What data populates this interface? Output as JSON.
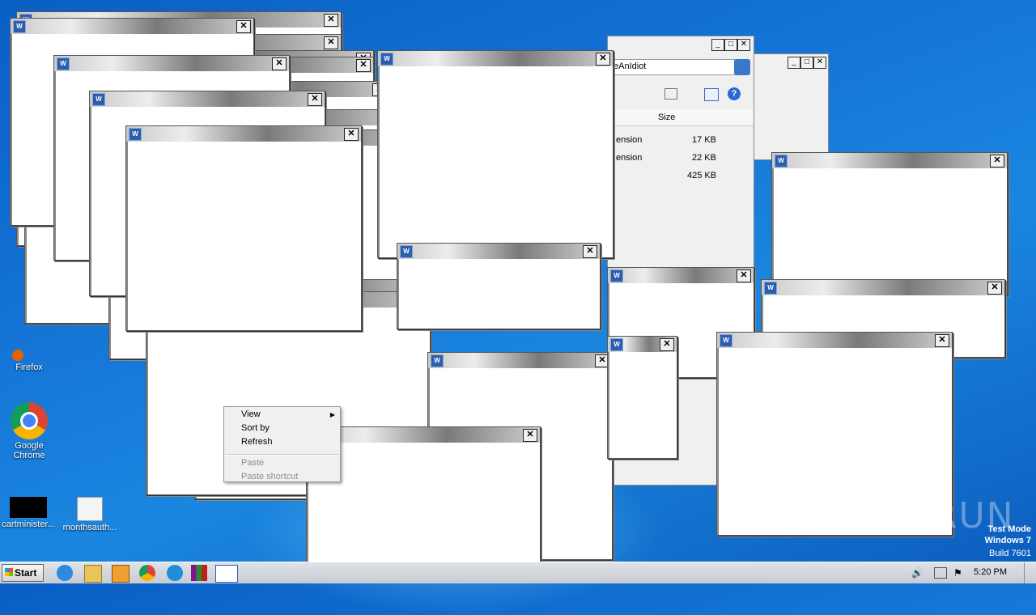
{
  "desktop": {
    "icons": [
      {
        "label": "Firefox"
      },
      {
        "label": "Google Chrome"
      },
      {
        "label": "cartminister..."
      },
      {
        "label": "monthsauth..."
      }
    ]
  },
  "explorer": {
    "search_value": "eAnIdiot",
    "column_size": "Size",
    "files": [
      {
        "type": "ension",
        "size": "17 KB"
      },
      {
        "type": "ension",
        "size": "22 KB"
      },
      {
        "type": "",
        "size": "425 KB"
      }
    ]
  },
  "context_menu": {
    "view": "View",
    "sort_by": "Sort by",
    "refresh": "Refresh",
    "paste": "Paste",
    "paste_shortcut": "Paste shortcut"
  },
  "taskbar": {
    "start_label": "Start",
    "clock": "5:20 PM"
  },
  "watermark": {
    "mode": "Test Mode",
    "os": "Windows 7",
    "build": "Build 7601",
    "brand": "ANY RUN"
  },
  "popup_icon_glyph": "W",
  "close_glyph": "✕"
}
